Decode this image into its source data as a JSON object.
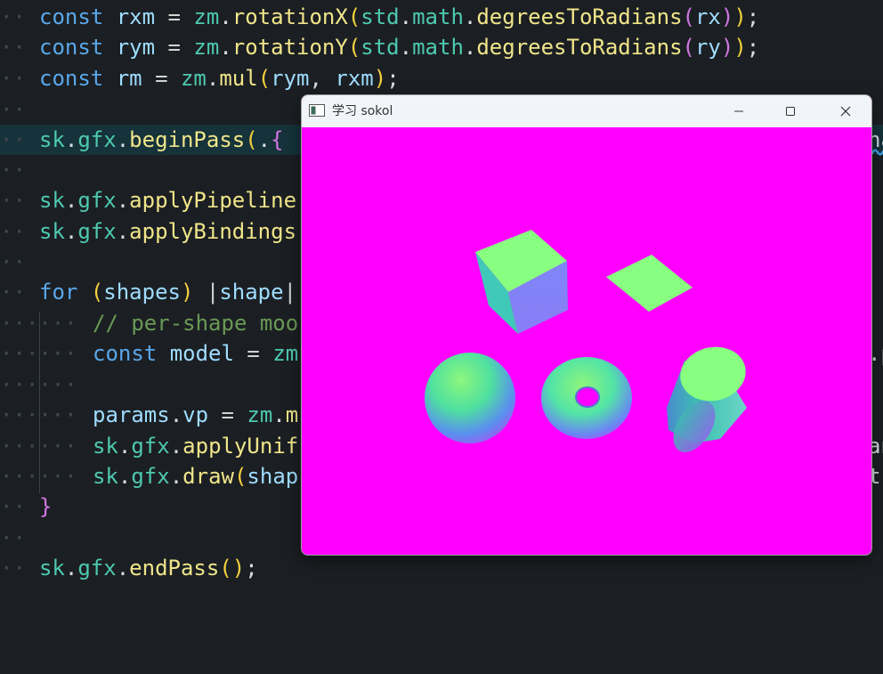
{
  "editor": {
    "lines": [
      {
        "text": "const rxm = zm.rotationX(std.math.degreesToRadians(rx));"
      },
      {
        "text": "const rym = zm.rotationY(std.math.degreesToRadians(ry));"
      },
      {
        "text": "const rm = zm.mul(rym, rxm);"
      },
      {
        "text": ""
      },
      {
        "text": "sk.gfx.beginPass(.{",
        "overflow": "na"
      },
      {
        "text": ""
      },
      {
        "text": "sk.gfx.applyPipeline"
      },
      {
        "text": "sk.gfx.applyBindings"
      },
      {
        "text": ""
      },
      {
        "text": "for (shapes) |shape|"
      },
      {
        "text": "    // per-shape moo"
      },
      {
        "text": "    const model = zm",
        "overflow": ".p"
      },
      {
        "text": ""
      },
      {
        "text": "    params.vp = zm.m"
      },
      {
        "text": "    sk.gfx.applyUnif",
        "overflow": "an"
      },
      {
        "text": "    sk.gfx.draw(shap",
        "overflow": "ts"
      },
      {
        "text": "}"
      },
      {
        "text": ""
      },
      {
        "text": "sk.gfx.endPass();"
      }
    ]
  },
  "window": {
    "title": "学习 sokol",
    "background_color": "#ff00ff",
    "icons": {
      "app": "app-window-icon",
      "minimize": "minimize-icon",
      "maximize": "maximize-icon",
      "close": "close-icon"
    },
    "shapes": [
      {
        "name": "cube"
      },
      {
        "name": "plane"
      },
      {
        "name": "sphere"
      },
      {
        "name": "torus"
      },
      {
        "name": "cylinder"
      }
    ]
  }
}
